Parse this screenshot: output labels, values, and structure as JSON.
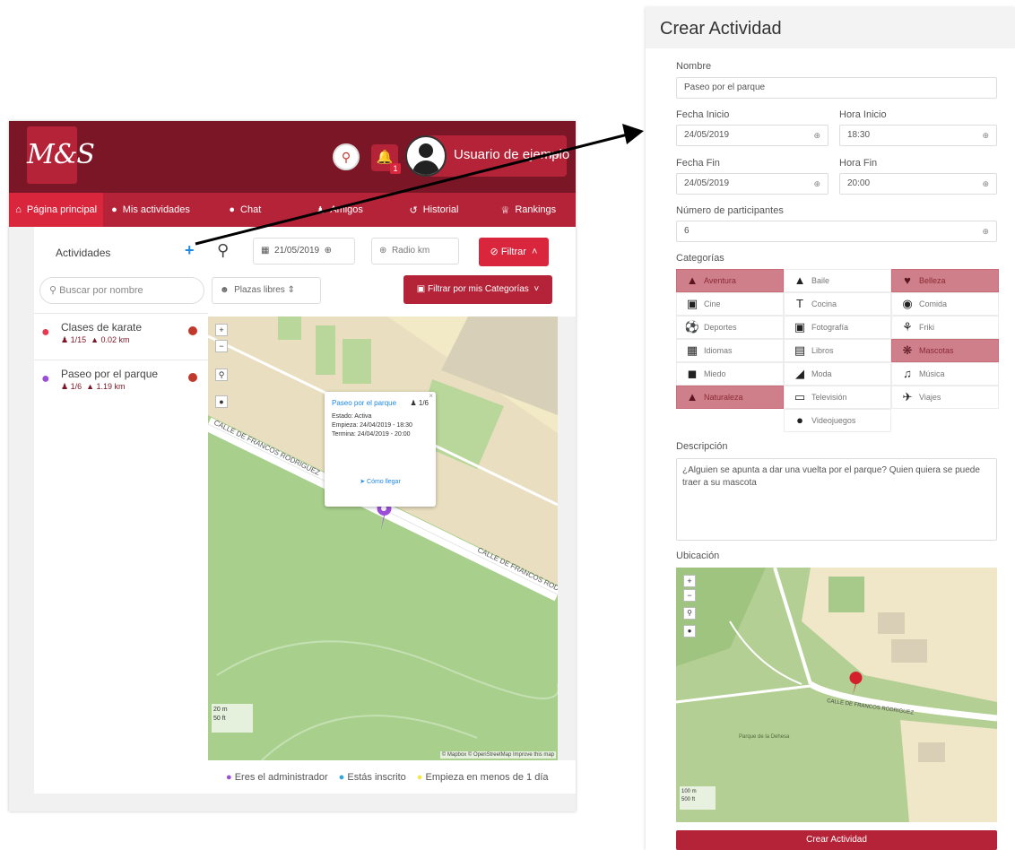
{
  "app": {
    "logo": "M&S",
    "notification_count": "1",
    "user_name": "Usuario de ejemplo",
    "nav": [
      {
        "label": "Página principal",
        "icon": "home-icon",
        "active": true
      },
      {
        "label": "Mis actividades",
        "icon": "map-pin-icon"
      },
      {
        "label": "Chat",
        "icon": "chat-icon"
      },
      {
        "label": "Amigos",
        "icon": "friends-icon"
      },
      {
        "label": "Historial",
        "icon": "history-icon"
      },
      {
        "label": "Rankings",
        "icon": "crown-icon"
      }
    ],
    "sidebar": {
      "title": "Actividades",
      "search_placeholder": "Buscar por nombre",
      "activities": [
        {
          "name": "Clases de karate",
          "participants": "1/15",
          "distance": "0.02 km",
          "pin_color": "#e53950"
        },
        {
          "name": "Paseo por el parque",
          "participants": "1/6",
          "distance": "1.19 km",
          "pin_color": "#9b4fd8"
        }
      ]
    },
    "controls": {
      "date": "21/05/2019",
      "radius_placeholder": "Radio km",
      "filter_label": "Filtrar",
      "plazas_label": "Plazas libres",
      "filter_categories_label": "Filtrar por mis Categorías"
    },
    "map": {
      "street": "CALLE DE FRANCOS RODRIGUEZ",
      "scale_m": "20 m",
      "scale_ft": "50 ft",
      "attribution": "© Mapbox © OpenStreetMap Improve this map",
      "popup": {
        "title": "Paseo por el parque",
        "participants": "1/6",
        "status": "Estado: Activa",
        "start": "Empieza: 24/04/2019 - 18:30",
        "end": "Termina: 24/04/2019 - 20:00",
        "route": "Cómo llegar"
      }
    },
    "legend": [
      {
        "label": "Eres el administrador",
        "color": "#9b4fd8"
      },
      {
        "label": "Estás inscrito",
        "color": "#2fa8e0"
      },
      {
        "label": "Empieza en menos de 1 día",
        "color": "#f5e94a"
      }
    ]
  },
  "form": {
    "title": "Crear Actividad",
    "name_label": "Nombre",
    "name_value": "Paseo por el parque",
    "start_date_label": "Fecha Inicio",
    "start_date": "24/05/2019",
    "start_time_label": "Hora Inicio",
    "start_time": "18:30",
    "end_date_label": "Fecha Fin",
    "end_date": "24/05/2019",
    "end_time_label": "Hora Fin",
    "end_time": "20:00",
    "participants_label": "Número de participantes",
    "participants_value": "6",
    "categories_label": "Categorías",
    "categories": [
      {
        "label": "Aventura",
        "icon": "hiker-icon",
        "selected": true
      },
      {
        "label": "Baile",
        "icon": "dress-icon",
        "selected": false
      },
      {
        "label": "Belleza",
        "icon": "heart-icon",
        "selected": true
      },
      {
        "label": "Cine",
        "icon": "film-icon",
        "selected": false
      },
      {
        "label": "Cocina",
        "icon": "cutlery-icon",
        "selected": false
      },
      {
        "label": "Comida",
        "icon": "drumstick-icon",
        "selected": false
      },
      {
        "label": "Deportes",
        "icon": "ball-icon",
        "selected": false
      },
      {
        "label": "Fotografía",
        "icon": "camera-icon",
        "selected": false
      },
      {
        "label": "Friki",
        "icon": "rebel-icon",
        "selected": false
      },
      {
        "label": "Idiomas",
        "icon": "language-icon",
        "selected": false
      },
      {
        "label": "Libros",
        "icon": "book-icon",
        "selected": false
      },
      {
        "label": "Mascotas",
        "icon": "paw-icon",
        "selected": true
      },
      {
        "label": "Miedo",
        "icon": "ghost-icon",
        "selected": false
      },
      {
        "label": "Moda",
        "icon": "tshirt-icon",
        "selected": false
      },
      {
        "label": "Música",
        "icon": "music-icon",
        "selected": false
      },
      {
        "label": "Naturaleza",
        "icon": "bell-icon",
        "selected": true
      },
      {
        "label": "Televisión",
        "icon": "tv-icon",
        "selected": false
      },
      {
        "label": "Viajes",
        "icon": "plane-icon",
        "selected": false
      },
      {
        "label": "Videojuegos",
        "icon": "gamepad-icon",
        "selected": false
      }
    ],
    "description_label": "Descripción",
    "description": "¿Alguien se apunta a dar una vuelta por el parque? Quien quiera se puede traer a su mascota",
    "location_label": "Ubicación",
    "location_map": {
      "street": "CALLE DE FRANCOS RODRIGUEZ",
      "park": "Parque de la Dehesa",
      "scale_m": "100 m",
      "scale_ft": "500 ft"
    },
    "submit_label": "Crear Actividad"
  },
  "colors": {
    "brand_dark": "#7a1626",
    "brand": "#b42338",
    "brand_light": "#d9263c",
    "category_selected": "#cf7f8a"
  }
}
